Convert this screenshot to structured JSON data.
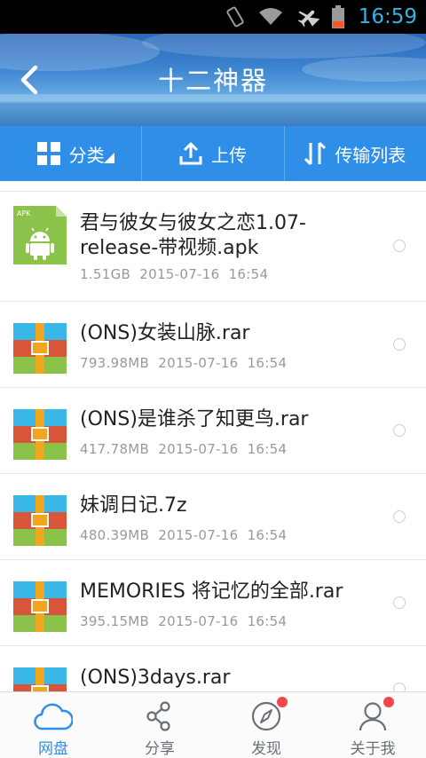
{
  "status_bar": {
    "time": "16:59"
  },
  "header": {
    "title": "十二神器"
  },
  "toolbar": {
    "category_label": "分类",
    "upload_label": "上传",
    "transfer_label": "传输列表"
  },
  "files": [
    {
      "name": "君与彼女与彼女之恋1.07-release-带视频.apk",
      "size": "1.51GB",
      "date": "2015-07-16",
      "time": "16:54",
      "type": "apk",
      "icon_tag": "APK"
    },
    {
      "name": "(ONS)女装山脉.rar",
      "size": "793.98MB",
      "date": "2015-07-16",
      "time": "16:54",
      "type": "archive"
    },
    {
      "name": "(ONS)是谁杀了知更鸟.rar",
      "size": "417.78MB",
      "date": "2015-07-16",
      "time": "16:54",
      "type": "archive"
    },
    {
      "name": "妹调日记.7z",
      "size": "480.39MB",
      "date": "2015-07-16",
      "time": "16:54",
      "type": "archive"
    },
    {
      "name": "MEMORIES 将记忆的全部.rar",
      "size": "395.15MB",
      "date": "2015-07-16",
      "time": "16:54",
      "type": "archive"
    },
    {
      "name": "(ONS)3days.rar",
      "size": "",
      "date": "",
      "time": "",
      "type": "archive"
    }
  ],
  "tabs": [
    {
      "label": "网盘",
      "icon": "cloud-icon",
      "active": true,
      "badge": false
    },
    {
      "label": "分享",
      "icon": "share-icon",
      "active": false,
      "badge": false
    },
    {
      "label": "发现",
      "icon": "compass-icon",
      "active": false,
      "badge": true
    },
    {
      "label": "关于我",
      "icon": "user-icon",
      "active": false,
      "badge": true
    }
  ],
  "colors": {
    "accent": "#2f8fe8",
    "status_text": "#33b5e5",
    "badge": "#f04848",
    "apk_green": "#8bc34a"
  }
}
